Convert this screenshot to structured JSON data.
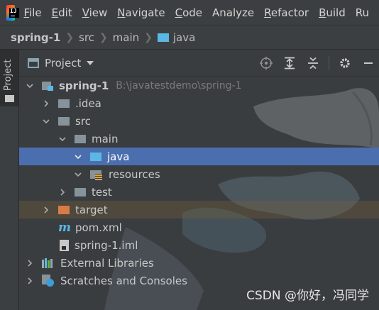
{
  "menubar": {
    "items": [
      {
        "mnemonic": "F",
        "rest": "ile"
      },
      {
        "mnemonic": "E",
        "rest": "dit"
      },
      {
        "mnemonic": "V",
        "rest": "iew"
      },
      {
        "mnemonic": "N",
        "rest": "avigate"
      },
      {
        "mnemonic": "C",
        "rest": "ode"
      },
      {
        "mnemonic": "",
        "rest": "Analyze"
      },
      {
        "mnemonic": "R",
        "rest": "efactor"
      },
      {
        "mnemonic": "B",
        "rest": "uild"
      },
      {
        "mnemonic": "",
        "rest": "Ru"
      }
    ]
  },
  "breadcrumb": {
    "items": [
      "spring-1",
      "src",
      "main",
      "java"
    ]
  },
  "stripe": {
    "tab_label": "Project"
  },
  "panel": {
    "title": "Project",
    "tools": [
      "locate-icon",
      "expand-all-icon",
      "collapse-all-icon",
      "gear-icon",
      "minimize-icon"
    ]
  },
  "tree": {
    "rows": [
      {
        "name": "spring-1",
        "hint": "B:\\javatestdemo\\spring-1"
      },
      {
        "name": ".idea"
      },
      {
        "name": "src"
      },
      {
        "name": "main"
      },
      {
        "name": "java"
      },
      {
        "name": "resources"
      },
      {
        "name": "test"
      },
      {
        "name": "target"
      },
      {
        "name": "pom.xml"
      },
      {
        "name": "spring-1.iml"
      },
      {
        "name": "External Libraries"
      },
      {
        "name": "Scratches and Consoles"
      }
    ]
  },
  "colors": {
    "selection": "#4b6eaf",
    "source_folder": "#5bb8e6",
    "excluded_folder": "#d97b45"
  },
  "watermark": "CSDN @你好，冯同学"
}
